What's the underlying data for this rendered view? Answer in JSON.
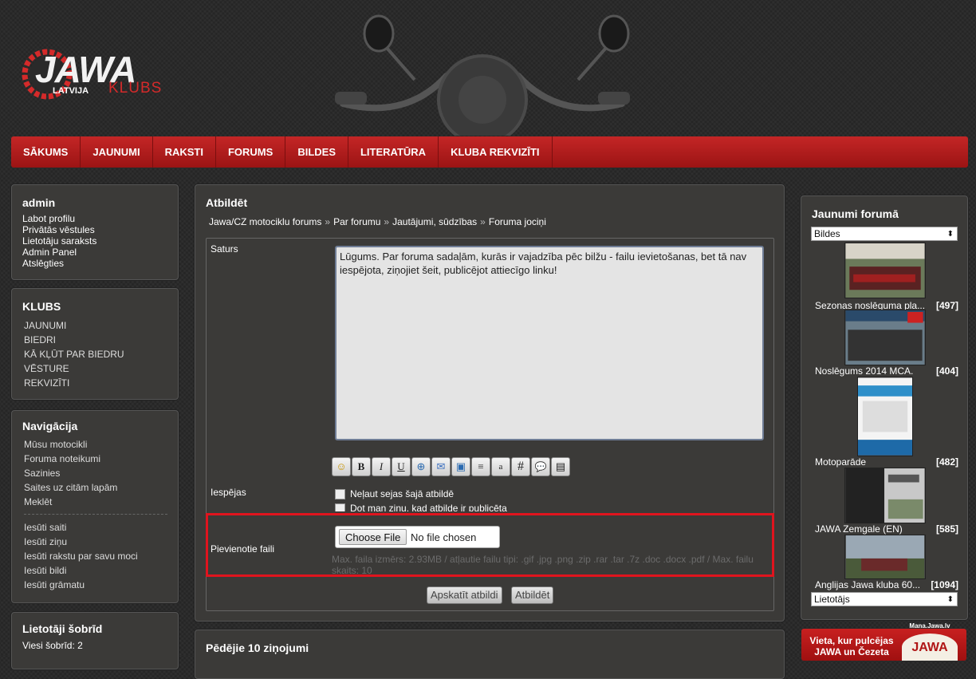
{
  "logo": {
    "brand": "JAWA",
    "country": "LATVIJA",
    "club": "KLUBS"
  },
  "nav": [
    "SĀKUMS",
    "JAUNUMI",
    "RAKSTI",
    "FORUMS",
    "BILDES",
    "LITERATŪRA",
    "KLUBA REKVIZĪTI"
  ],
  "user_panel": {
    "title": "admin",
    "links": [
      "Labot profilu",
      "Privātās vēstules",
      "Lietotāju saraksts",
      "Admin Panel",
      "Atslēgties"
    ]
  },
  "klubs_panel": {
    "title": "KLUBS",
    "links": [
      "JAUNUMI",
      "BIEDRI",
      "KĀ KĻŪT PAR BIEDRU",
      "VĒSTURE",
      "REKVIZĪTI"
    ]
  },
  "nav_panel": {
    "title": "Navigācija",
    "links": [
      "Mūsu motocikli",
      "Foruma noteikumi",
      "Sazinies",
      "Saites uz citām lapām",
      "Meklēt"
    ],
    "links2": [
      "Iesūti saiti",
      "Iesūti ziņu",
      "Iesūti rakstu par savu moci",
      "Iesūti bildi",
      "Iesūti grāmatu"
    ]
  },
  "online_panel": {
    "title": "Lietotāji šobrīd",
    "line": "Viesi šobrīd: 2"
  },
  "main": {
    "title": "Atbildēt",
    "breadcrumb": [
      "Jawa/CZ motociklu forums",
      "Par forumu",
      "Jautājumi, sūdzības",
      "Foruma jociņi"
    ],
    "breadcrumb_sep": "»",
    "content_label": "Saturs",
    "message": "Lūgums. Par foruma sadaļām, kurās ir vajadzība pēc bilžu - failu ievietošanas, bet tā nav iespējota, ziņojiet šeit, publicējot attiecīgo linku!",
    "toolbar": [
      {
        "name": "smiley-icon",
        "glyph": "☺"
      },
      {
        "name": "bold-icon",
        "glyph": "B"
      },
      {
        "name": "italic-icon",
        "glyph": "I"
      },
      {
        "name": "underline-icon",
        "glyph": "U"
      },
      {
        "name": "link-icon",
        "glyph": "⊕"
      },
      {
        "name": "email-icon",
        "glyph": "✉"
      },
      {
        "name": "image-icon",
        "glyph": "▣"
      },
      {
        "name": "align-icon",
        "glyph": "≡"
      },
      {
        "name": "small-text-icon",
        "glyph": "a"
      },
      {
        "name": "code-icon",
        "glyph": "#"
      },
      {
        "name": "quote-icon",
        "glyph": "💬"
      },
      {
        "name": "video-icon",
        "glyph": "▤"
      }
    ],
    "options_label": "Iespējas",
    "option1": "Neļaut sejas šajā atbildē",
    "option2": "Dot man ziņu, kad atbilde ir publicēta",
    "attach_label": "Pievienotie faili",
    "choose_file": "Choose File",
    "no_file": "No file chosen",
    "attach_info": "Max. faila izmērs: 2.93MB / atļautie failu tipi: .gif .jpg .png .zip .rar .tar .7z .doc .docx .pdf / Max. failu skaits: 10",
    "preview_button": "Apskatīt atbildi",
    "submit_button": "Atbildēt"
  },
  "latest_panel": {
    "title": "Pēdējie 10 ziņojumi"
  },
  "forum_panel": {
    "title": "Jaunumi forumā",
    "select_top": "Bildes",
    "select_bottom": "Lietotājs",
    "items": [
      {
        "title": "Sezonas noslēguma pla...",
        "count": "[497]"
      },
      {
        "title": "Noslēgums 2014 MCA.",
        "count": "[404]"
      },
      {
        "title": "Motoparāde",
        "count": "[482]"
      },
      {
        "title": "JAWA Zemgale (EN)",
        "count": "[585]"
      },
      {
        "title": "Anglijas Jawa kluba 60...",
        "count": "[1094]"
      }
    ]
  },
  "promo": {
    "text": "Vieta, kur pulcējas JAWA un Čezeta",
    "url_text": "Mana.Jawa.lv",
    "logo": "JAWA"
  },
  "colors": {
    "accent_red": "#c42626",
    "highlight_red": "#e0141e",
    "panel_bg": "#3b3a38"
  }
}
